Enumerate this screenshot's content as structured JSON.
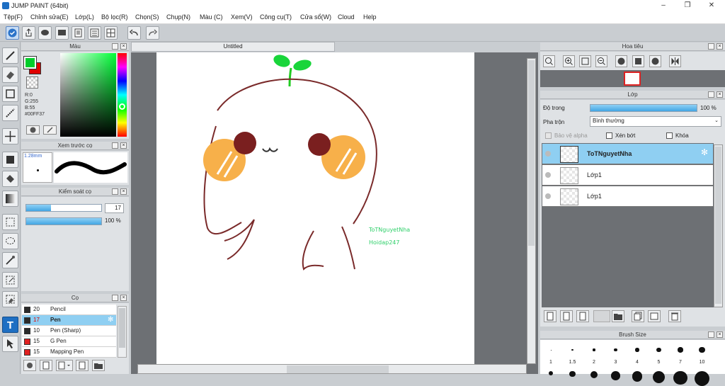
{
  "window": {
    "title": "JUMP PAINT (64bit)",
    "controls": [
      "–",
      "❐",
      "✕"
    ]
  },
  "menu": [
    "Tệp(F)",
    "Chỉnh sửa(E)",
    "Lớp(L)",
    "Bộ lọc(R)",
    "Chọn(S)",
    "Chụp(N)",
    "Màu (C)",
    "Xem(V)",
    "Công cụ(T)",
    "Cửa sổ(W)",
    "Cloud",
    "Help"
  ],
  "color_panel": {
    "title": "Màu",
    "r": "R:0",
    "g": "G:255",
    "b": "B:55",
    "hex": "#00FF37",
    "foreground": "#00cc2a",
    "background": "#e00000"
  },
  "brush_preview": {
    "title": "Xem trước cọ",
    "size": "1.28mm"
  },
  "brush_control": {
    "title": "Kiểm soát cọ",
    "size_value": "17",
    "size_fraction": 0.33,
    "opacity_value": "100 %",
    "opacity_fraction": 1.0
  },
  "brush_panel": {
    "title": "Cọ",
    "items": [
      {
        "size": "20",
        "name": "Pencil",
        "color": "#2a2a2a"
      },
      {
        "size": "17",
        "name": "Pen",
        "color": "#2a2a2a",
        "selected": true
      },
      {
        "size": "10",
        "name": "Pen (Sharp)",
        "color": "#2a2a2a"
      },
      {
        "size": "15",
        "name": "G Pen",
        "color": "#e02020"
      },
      {
        "size": "15",
        "name": "Mapping Pen",
        "color": "#e02020"
      }
    ]
  },
  "canvas": {
    "tab_title": "Untitled",
    "watermark_line1": "ToTNguyetNha",
    "watermark_line2": "Hoidap247"
  },
  "navigator": {
    "title": "Hoa tiêu"
  },
  "layer_panel": {
    "title": "Lớp",
    "opacity_label": "Độ trong",
    "opacity_value": "100 %",
    "opacity_fraction": 1.0,
    "blend_label": "Pha trộn",
    "blend_value": "Bình thường",
    "protect_alpha": "Bảo vệ alpha",
    "clipping": "Xén bớt",
    "lock": "Khóa",
    "layers": [
      {
        "name": "ToTNguyetNha",
        "selected": true
      },
      {
        "name": "Lớp1"
      },
      {
        "name": "Lớp1"
      }
    ]
  },
  "brush_size_panel": {
    "title": "Brush Size",
    "labels": [
      "1",
      "1.5",
      "2",
      "3",
      "4",
      "5",
      "7",
      "10"
    ]
  }
}
